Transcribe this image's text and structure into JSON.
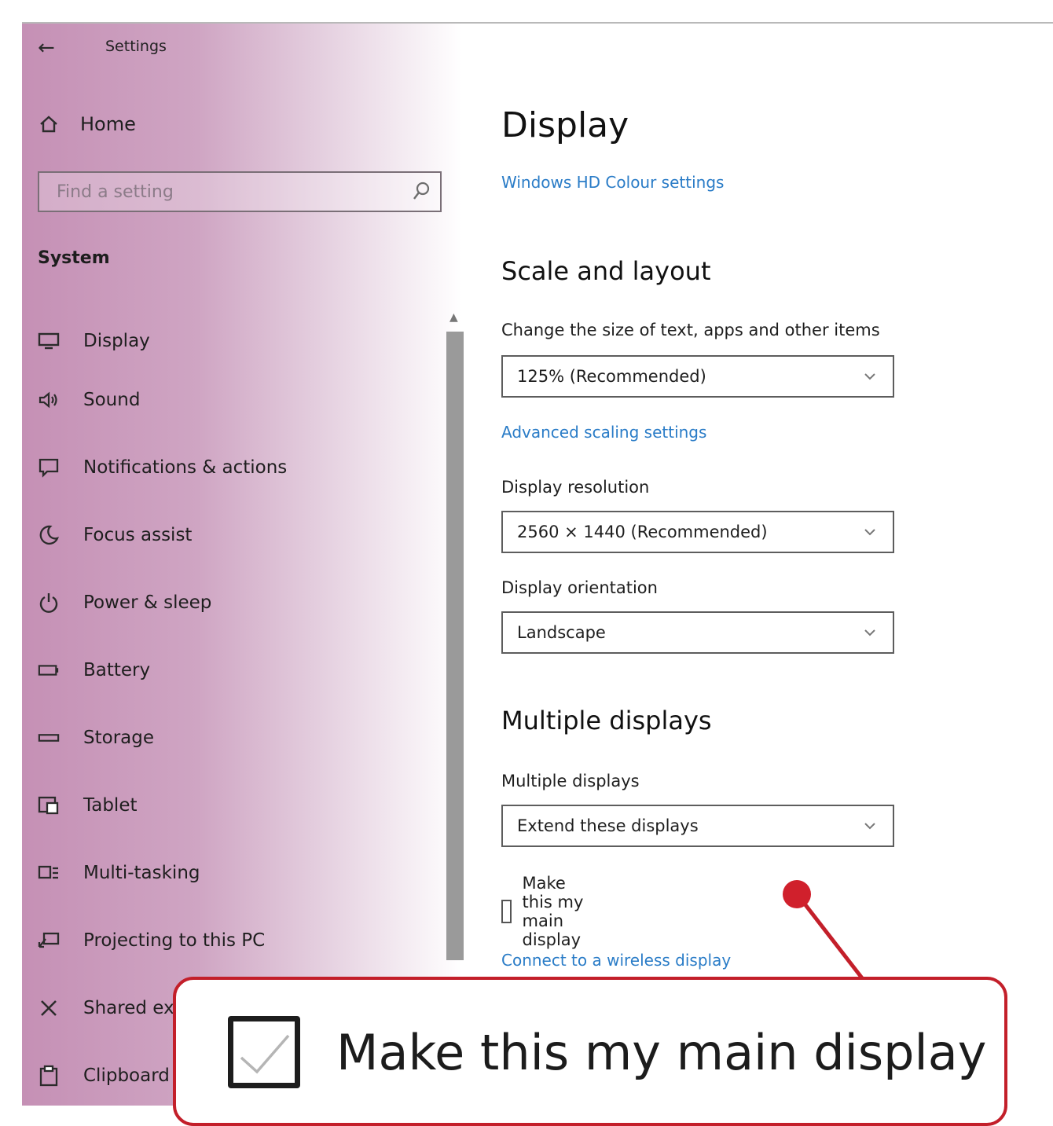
{
  "window": {
    "title": "Settings"
  },
  "sidebar": {
    "home": "Home",
    "search_placeholder": "Find a setting",
    "section": "System",
    "items": [
      {
        "label": "Display",
        "icon": "monitor-icon"
      },
      {
        "label": "Sound",
        "icon": "speaker-icon"
      },
      {
        "label": "Notifications & actions",
        "icon": "notification-icon"
      },
      {
        "label": "Focus assist",
        "icon": "moon-icon"
      },
      {
        "label": "Power & sleep",
        "icon": "power-icon"
      },
      {
        "label": "Battery",
        "icon": "battery-icon"
      },
      {
        "label": "Storage",
        "icon": "storage-icon"
      },
      {
        "label": "Tablet",
        "icon": "tablet-icon"
      },
      {
        "label": "Multi-tasking",
        "icon": "multitasking-icon"
      },
      {
        "label": "Projecting to this PC",
        "icon": "projecting-icon"
      },
      {
        "label": "Shared ex",
        "icon": "shared-icon"
      },
      {
        "label": "Clipboard",
        "icon": "clipboard-icon"
      }
    ]
  },
  "main": {
    "title": "Display",
    "hd_link": "Windows HD Colour settings",
    "scale_heading": "Scale and layout",
    "scale_label": "Change the size of text, apps and other items",
    "scale_value": "125% (Recommended)",
    "advanced_link": "Advanced scaling settings",
    "resolution_label": "Display resolution",
    "resolution_value": "2560 × 1440 (Recommended)",
    "orientation_label": "Display orientation",
    "orientation_value": "Landscape",
    "multi_heading": "Multiple displays",
    "multi_label": "Multiple displays",
    "multi_value": "Extend these displays",
    "main_display_label": "Make this my main display",
    "main_display_checked": false,
    "wireless_link": "Connect to a wireless display"
  },
  "callout": {
    "text": "Make this my main display",
    "checked": true
  },
  "colors": {
    "accent_link": "#2a7cc7",
    "callout_red": "#c31f2a",
    "sidebar_tint": "#c590b5"
  }
}
